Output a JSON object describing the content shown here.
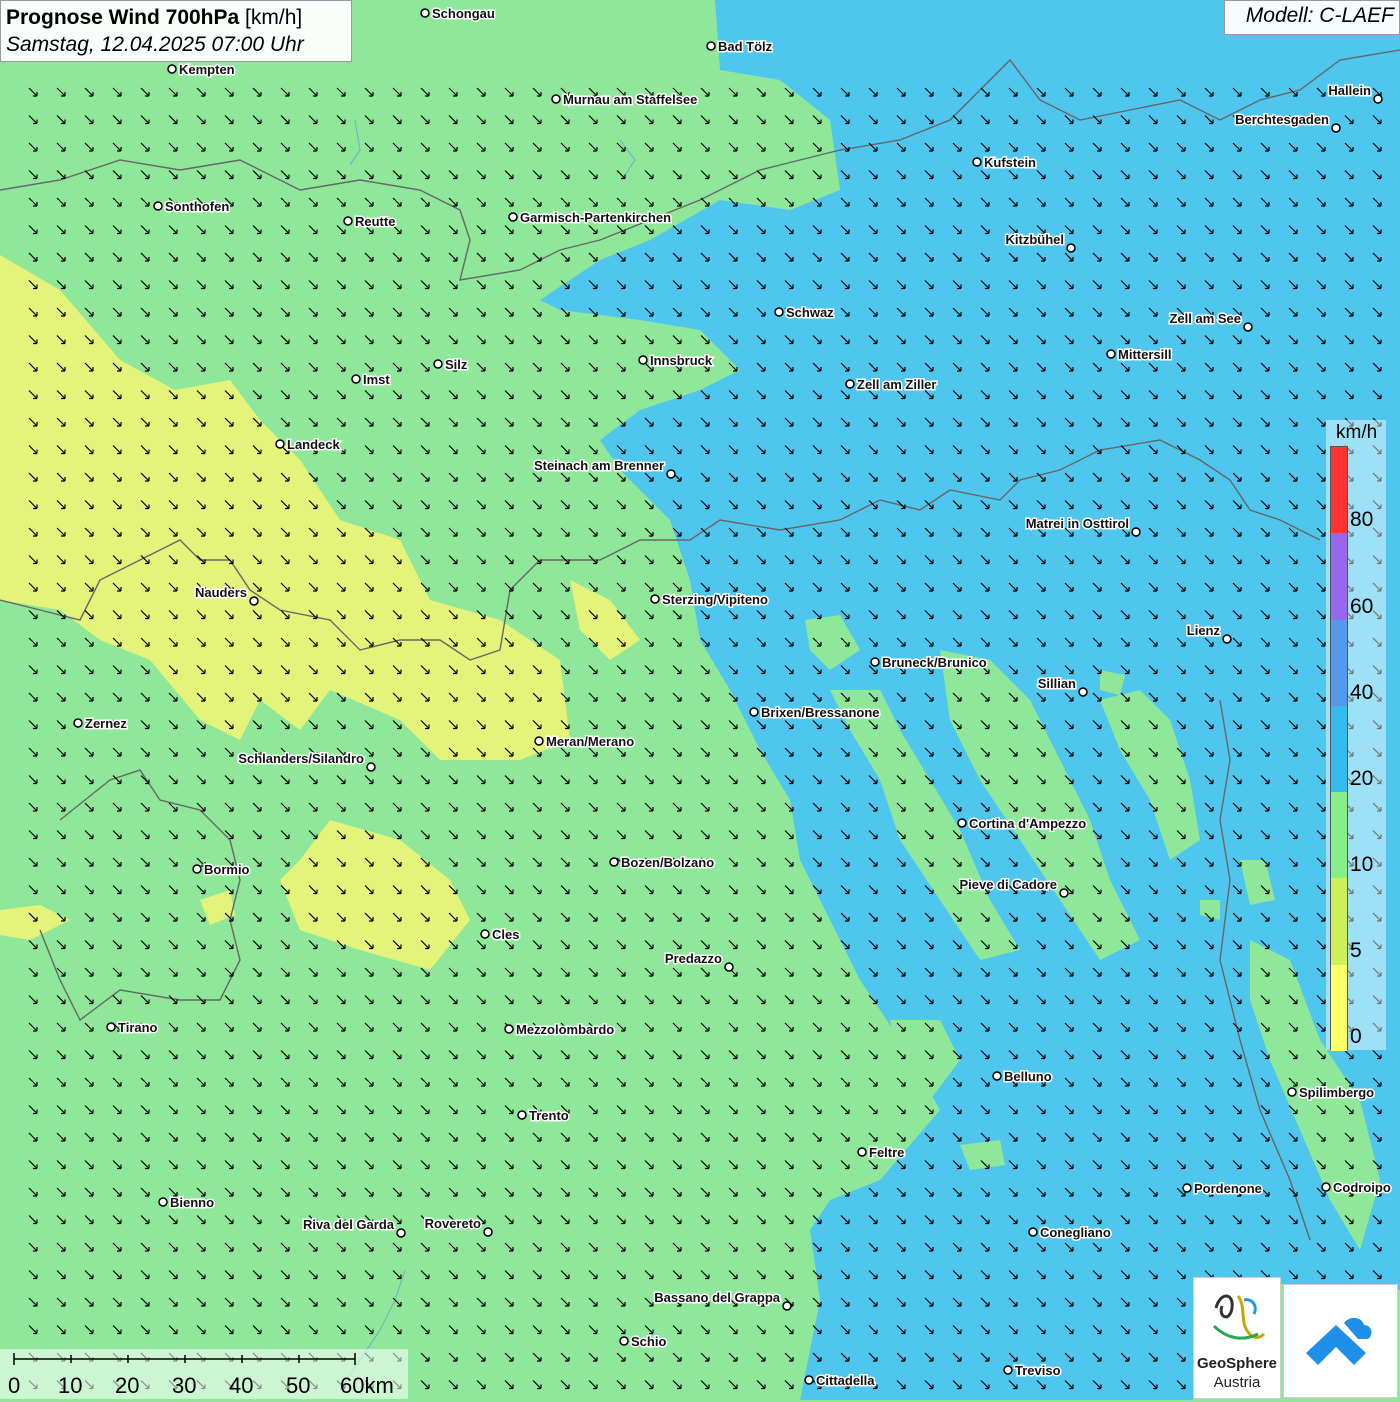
{
  "header": {
    "title_main": "Prognose Wind 700hPa",
    "title_unit": "[km/h]",
    "subtitle": "Samstag, 12.04.2025 07:00 Uhr",
    "model": "Modell: C-LAEF"
  },
  "legend": {
    "unit": "km/h",
    "ticks": [
      "80",
      "60",
      "40",
      "20",
      "10",
      "5",
      "0"
    ],
    "colors": [
      "#ff3333",
      "#9966ee",
      "#5599ee",
      "#33bbee",
      "#88ee88",
      "#ccf055",
      "#ffff66"
    ]
  },
  "colors": {
    "calm_yellow": "#e4f37a",
    "light_green": "#8fe89a",
    "blue": "#4fc6ee",
    "arrow": "#000000",
    "border_line": "#555555"
  },
  "scale_bar": {
    "labels": [
      "0",
      "10",
      "20",
      "30",
      "40",
      "50",
      "60km"
    ]
  },
  "cities": [
    {
      "name": "Schongau"
    },
    {
      "name": "Bad Tölz"
    },
    {
      "name": "Kempten"
    },
    {
      "name": "Murnau am Staffelsee"
    },
    {
      "name": "Hallein"
    },
    {
      "name": "Berchtesgaden"
    },
    {
      "name": "Kufstein"
    },
    {
      "name": "Sonthofen"
    },
    {
      "name": "Reutte"
    },
    {
      "name": "Garmisch-Partenkirchen"
    },
    {
      "name": "Kitzbühel"
    },
    {
      "name": "Schwaz"
    },
    {
      "name": "Zell am See"
    },
    {
      "name": "Mittersill"
    },
    {
      "name": "Innsbruck"
    },
    {
      "name": "Silz"
    },
    {
      "name": "Imst"
    },
    {
      "name": "Zell am Ziller"
    },
    {
      "name": "Landeck"
    },
    {
      "name": "Steinach am Brenner"
    },
    {
      "name": "Matrei in Osttirol"
    },
    {
      "name": "Nauders"
    },
    {
      "name": "Sterzing/Vipiteno"
    },
    {
      "name": "Lienz"
    },
    {
      "name": "Bruneck/Brunico"
    },
    {
      "name": "Sillian"
    },
    {
      "name": "Brixen/Bressanone"
    },
    {
      "name": "Zernez"
    },
    {
      "name": "Meran/Merano"
    },
    {
      "name": "Schlanders/Silandro"
    },
    {
      "name": "Cortina d'Ampezzo"
    },
    {
      "name": "Bozen/Bolzano"
    },
    {
      "name": "Bormio"
    },
    {
      "name": "Pieve di Cadore"
    },
    {
      "name": "Cles"
    },
    {
      "name": "Predazzo"
    },
    {
      "name": "Tirano"
    },
    {
      "name": "Mezzolombardo"
    },
    {
      "name": "Belluno"
    },
    {
      "name": "Spilimbergo"
    },
    {
      "name": "Trento"
    },
    {
      "name": "Feltre"
    },
    {
      "name": "Pordenone"
    },
    {
      "name": "Codroipo"
    },
    {
      "name": "Bienno"
    },
    {
      "name": "Riva del Garda"
    },
    {
      "name": "Rovereto"
    },
    {
      "name": "Conegliano"
    },
    {
      "name": "Bassano del Grappa"
    },
    {
      "name": "Schio"
    },
    {
      "name": "Treviso"
    },
    {
      "name": "Cittadella"
    }
  ],
  "logos": {
    "geosphere_line1": "GeoSphere",
    "geosphere_line2": "Austria"
  }
}
